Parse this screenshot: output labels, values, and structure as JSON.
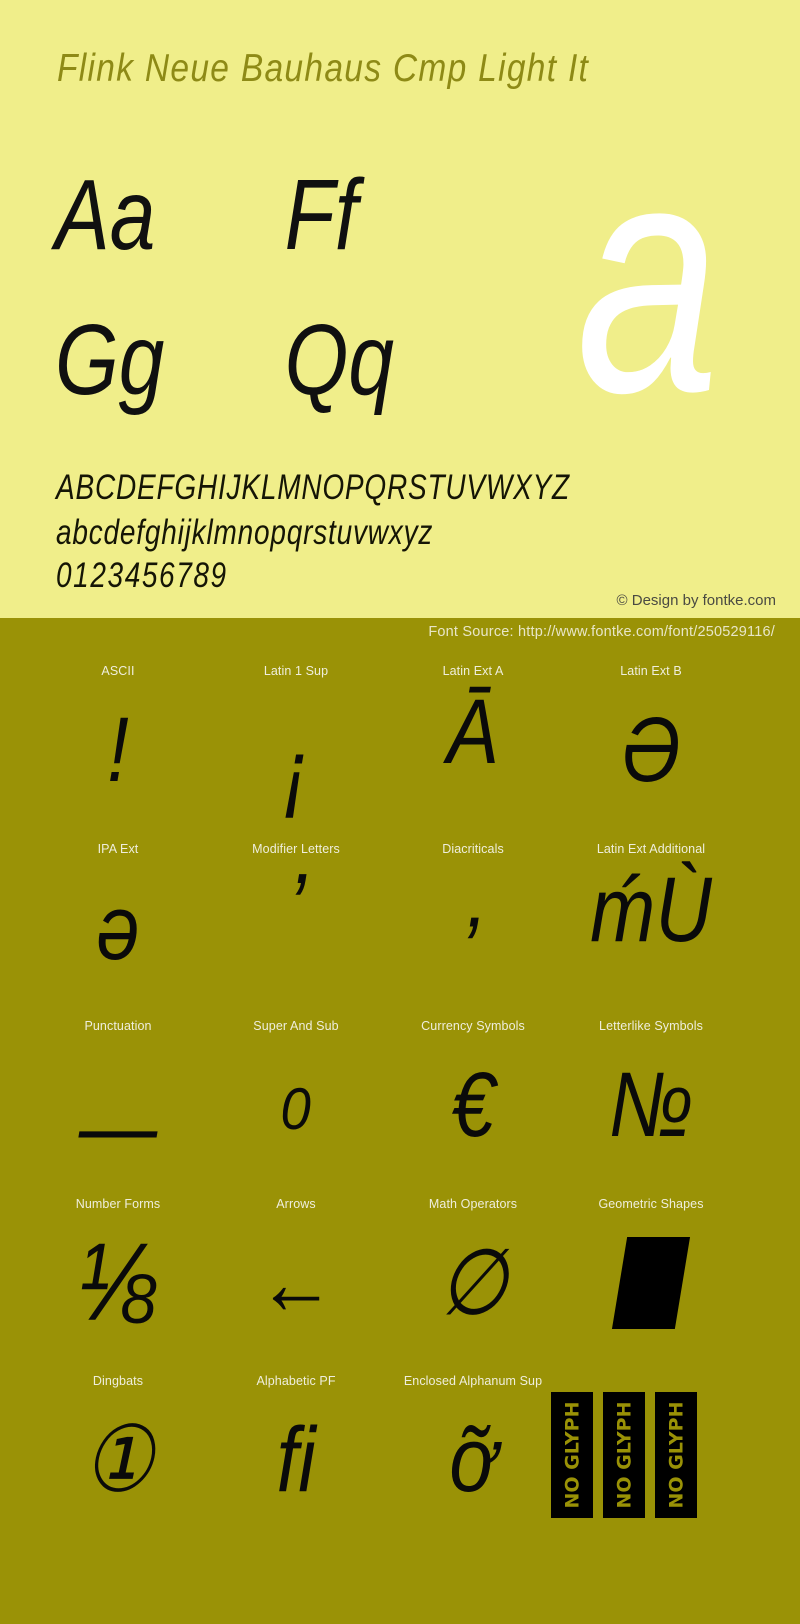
{
  "specimen": {
    "title": "Flink Neue Bauhaus Cmp Light It",
    "hero_glyph": "a",
    "letter_pairs": [
      [
        "Aa",
        "Ff"
      ],
      [
        "Gg",
        "Qq"
      ]
    ],
    "alphabet_upper": "ABCDEFGHIJKLMNOPQRSTUVWXYZ",
    "alphabet_lower": "abcdefghijklmnopqrstuvwxyz",
    "digits": "0123456789",
    "copyright": "© Design by fontke.com",
    "font_source": "Font Source: http://www.fontke.com/font/250529116/",
    "no_glyph_label": "NO GLYPH"
  },
  "colors": {
    "top_background": "#f0ee8a",
    "bottom_background": "#9a9206",
    "title": "#8e8a16",
    "glyph_black": "#0a0a0a",
    "hero_white": "#ffffff",
    "label_light": "#efeedd",
    "copyright_gray": "#4a4a42"
  },
  "unicode_ranges": [
    [
      {
        "label": "ASCII",
        "glyph": "!",
        "style": ""
      },
      {
        "label": "Latin 1 Sup",
        "glyph": "¡",
        "style": "shift-down"
      },
      {
        "label": "Latin Ext A",
        "glyph": "Ā",
        "style": "shift-up"
      },
      {
        "label": "Latin Ext B",
        "glyph": "Ə",
        "style": ""
      }
    ],
    [
      {
        "label": "IPA Ext",
        "glyph": "ə",
        "style": ""
      },
      {
        "label": "Modifier Letters",
        "glyph": "ʼ",
        "style": "shift-up"
      },
      {
        "label": "Diacriticals",
        "glyph": "̓",
        "style": "shift-down"
      },
      {
        "label": "Latin Ext Additional",
        "glyph": "ḿÙ",
        "style": "shift-up"
      }
    ],
    [
      {
        "label": "Punctuation",
        "glyph": "—",
        "style": "shift-down"
      },
      {
        "label": "Super And Sub",
        "glyph": "₀",
        "style": "shift-up"
      },
      {
        "label": "Currency Symbols",
        "glyph": "€",
        "style": ""
      },
      {
        "label": "Letterlike Symbols",
        "glyph": "№",
        "style": ""
      }
    ],
    [
      {
        "label": "Number Forms",
        "glyph": "⅛",
        "style": "tall"
      },
      {
        "label": "Arrows",
        "glyph": "←",
        "style": ""
      },
      {
        "label": "Math Operators",
        "glyph": "∅",
        "style": ""
      },
      {
        "label": "Geometric Shapes",
        "glyph": "",
        "style": "shape"
      }
    ],
    [
      {
        "label": "Dingbats",
        "glyph": "①",
        "style": ""
      },
      {
        "label": "Alphabetic PF",
        "glyph": "ﬁ",
        "style": ""
      },
      {
        "label": "Enclosed Alphanum Sup",
        "glyph": "ỡ",
        "style": ""
      },
      {
        "label": "",
        "glyph": "",
        "style": "noglyph",
        "no_glyph_count": 3
      }
    ]
  ]
}
